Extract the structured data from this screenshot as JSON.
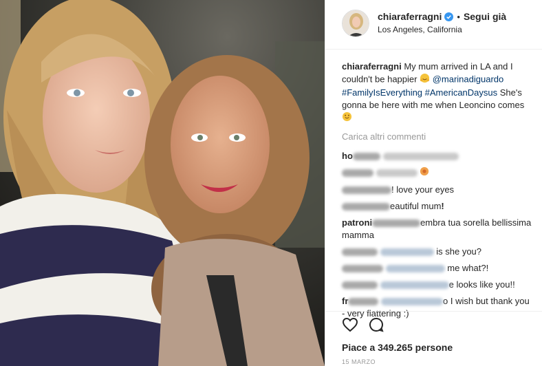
{
  "header": {
    "username": "chiaraferragni",
    "separator": "•",
    "follow_label": "Segui già",
    "location": "Los Angeles, California"
  },
  "caption": {
    "username": "chiaraferragni",
    "text_1": "My mum arrived in LA and I couldn't be happier",
    "mention": "@marinadiguardo",
    "hashtags": "#FamilyIsEverything #AmericanDaysus",
    "text_2": "She's gonna be here with me when Leoncino comes"
  },
  "load_more": "Carica altri commenti",
  "comments": [
    {
      "user": "ho",
      "text": ""
    },
    {
      "user": "",
      "text": ""
    },
    {
      "user": "",
      "text": "! love your eyes"
    },
    {
      "user": "",
      "text": "eautiful mum"
    },
    {
      "user": "patroni",
      "text": "embra tua sorella bellissima mamma"
    },
    {
      "user": "",
      "text": "is she you?"
    },
    {
      "user": "",
      "text": "me what?!"
    },
    {
      "user": "",
      "text": "e looks like you!!"
    },
    {
      "user": "fr",
      "text": "o I wish but thank you - very flattering :)"
    }
  ],
  "likes": "Piace a 349.265 persone",
  "date": "15 MARZO",
  "icons": {
    "verified": "verified-badge-icon",
    "like": "heart-icon",
    "comment": "comment-bubble-icon"
  },
  "colors": {
    "verified_blue": "#3897f0",
    "link": "#003569",
    "muted": "#999999"
  }
}
